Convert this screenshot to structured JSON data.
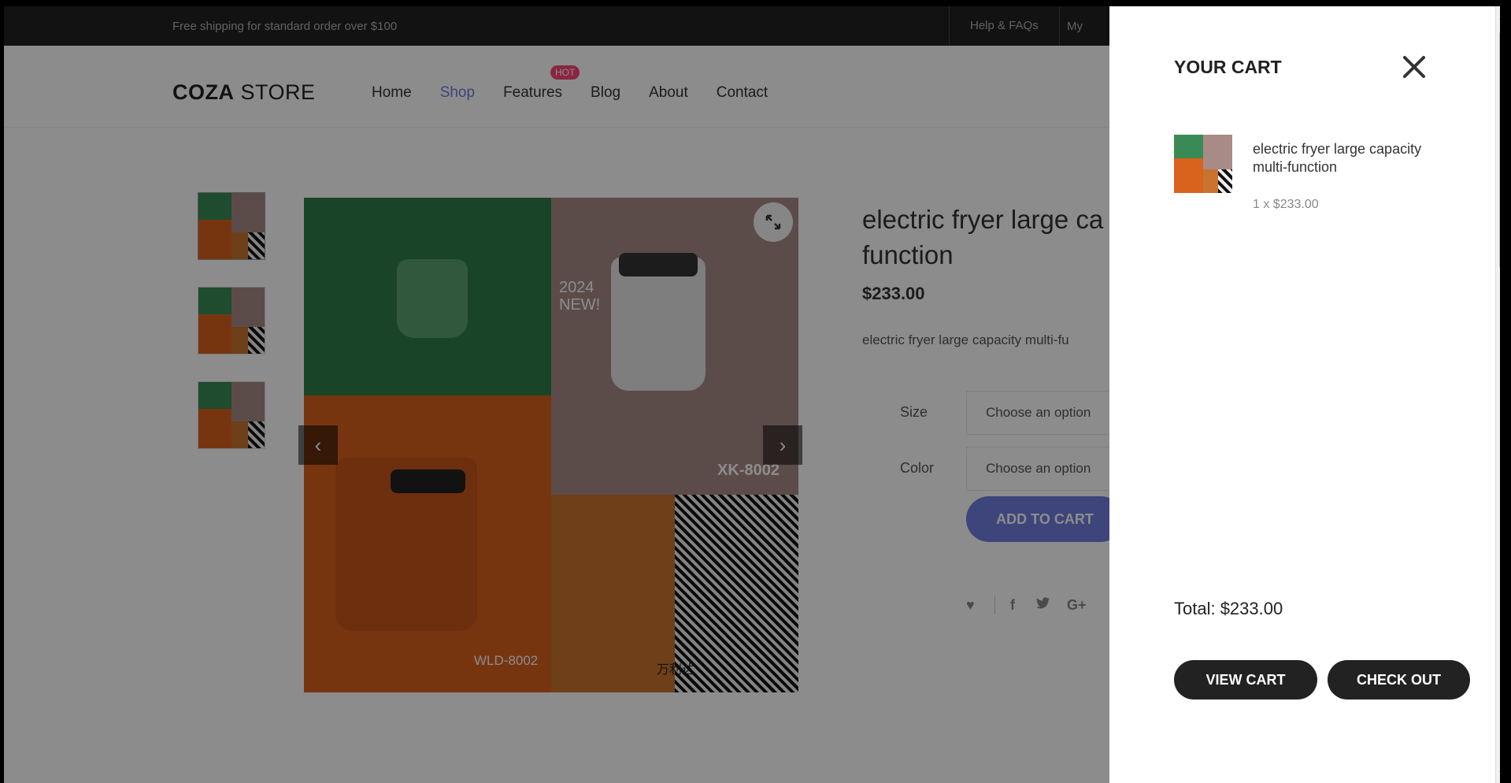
{
  "topbar": {
    "shipping_text": "Free shipping for standard order over $100",
    "help_link": "Help & FAQs",
    "account_link": "My"
  },
  "header": {
    "logo_bold": "COZA",
    "logo_light": " STORE",
    "hot_badge": "HOT",
    "nav": [
      "Home",
      "Shop",
      "Features",
      "Blog",
      "About",
      "Contact"
    ],
    "active_nav": "Shop"
  },
  "product": {
    "title": "electric fryer large capacity multi-function",
    "title_visible_line1": "electric fryer large ca",
    "title_visible_line2": "function",
    "price": "$233.00",
    "description_visible": "electric fryer large capacity multi-fu",
    "size_label": "Size",
    "size_placeholder": "Choose an option",
    "color_label": "Color",
    "color_placeholder": "Choose an option",
    "add_to_cart": "ADD TO CART",
    "image_text": {
      "badge_line1": "2024",
      "badge_line2": "NEW!",
      "model_a": "XK-8002",
      "model_b": "WLD-8002",
      "brand": "万利达"
    }
  },
  "cart": {
    "title": "YOUR CART",
    "items": [
      {
        "name": "electric fryer large capacity multi-function",
        "qty_price": "1 x $233.00"
      }
    ],
    "total": "Total: $233.00",
    "view_cart": "VIEW CART",
    "checkout": "CHECK OUT"
  },
  "colors": {
    "accent": "#717fe0",
    "hot": "#f74877",
    "dark": "#222222"
  },
  "icons": [
    "expand-icon",
    "prev-arrow-icon",
    "next-arrow-icon",
    "heart-icon",
    "facebook-icon",
    "twitter-icon",
    "google-plus-icon",
    "close-icon"
  ]
}
